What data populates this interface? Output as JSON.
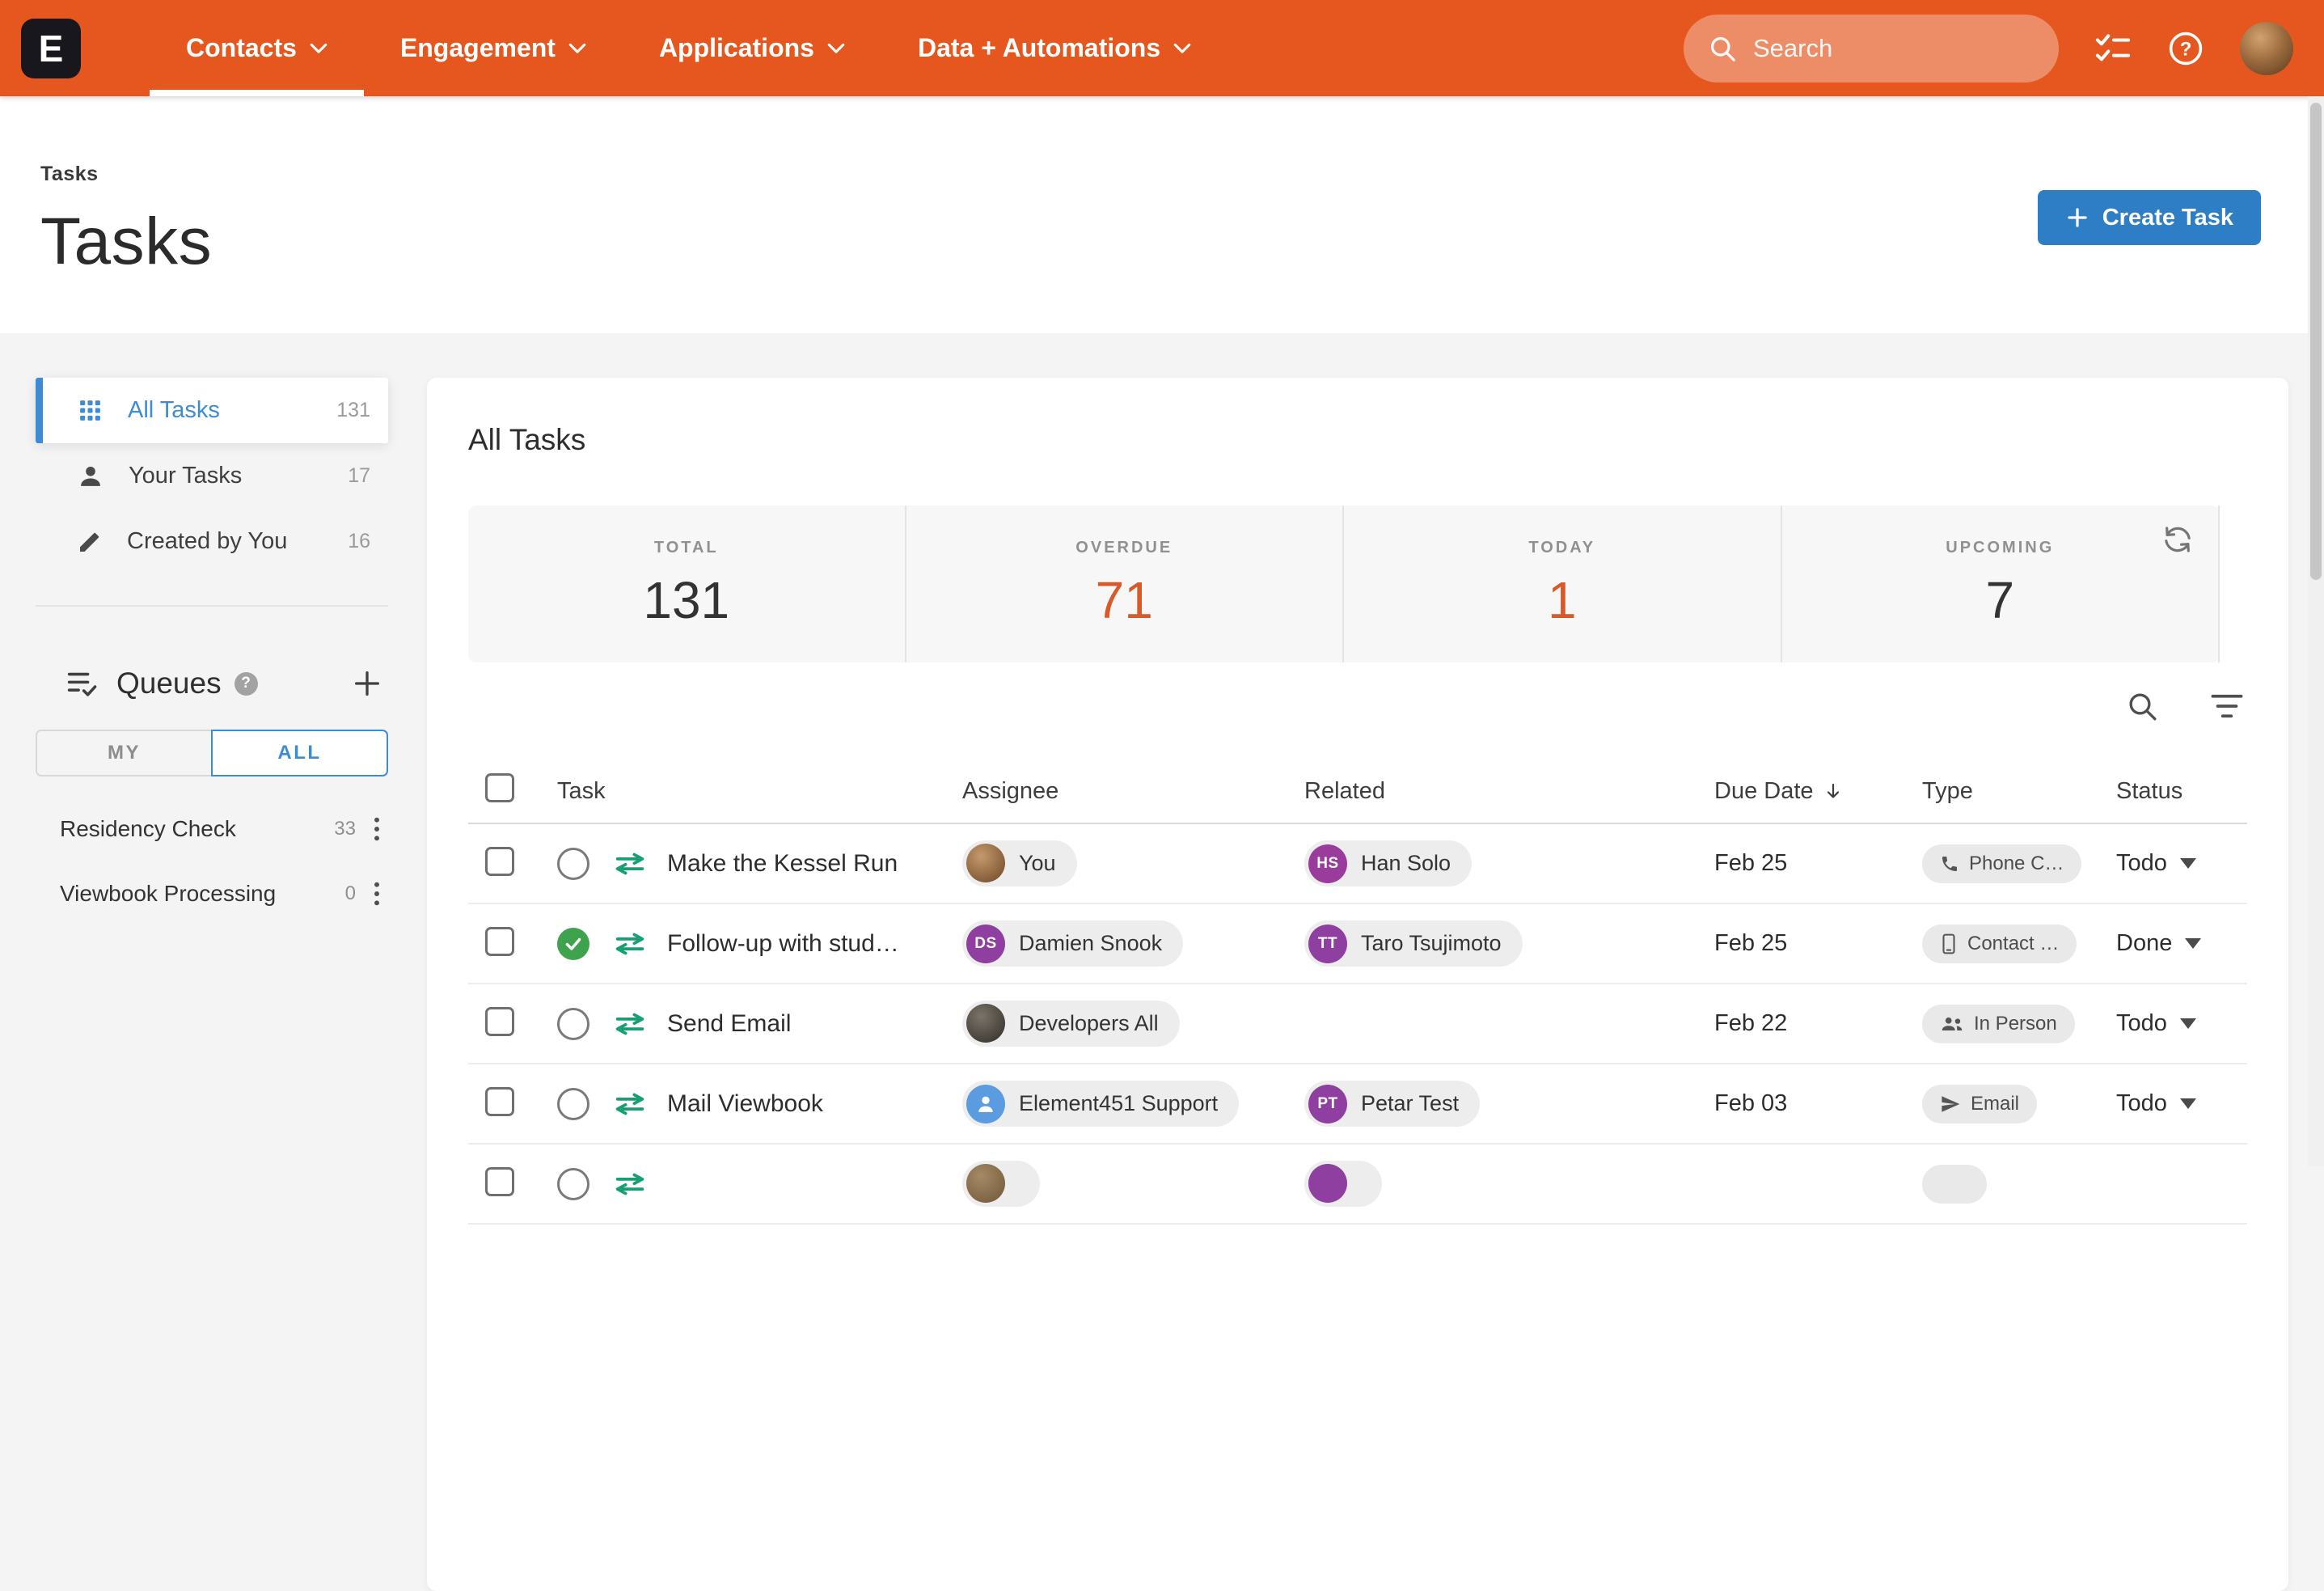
{
  "colors": {
    "header_orange": "#e5571f",
    "button_blue": "#2e7ec6",
    "link_blue": "#3d8bd4",
    "highlight_orange": "#d75a2b",
    "done_green": "#3fa24c",
    "transfer_green": "#16a071"
  },
  "header": {
    "logo": "E",
    "nav": [
      {
        "label": "Contacts",
        "active": true
      },
      {
        "label": "Engagement",
        "active": false
      },
      {
        "label": "Applications",
        "active": false
      },
      {
        "label": "Data + Automations",
        "active": false
      }
    ],
    "search_placeholder": "Search"
  },
  "page": {
    "breadcrumb": "Tasks",
    "title": "Tasks",
    "create_button": "Create Task"
  },
  "sidebar": {
    "items": [
      {
        "label": "All Tasks",
        "count": "131",
        "active": true,
        "icon": "grid"
      },
      {
        "label": "Your Tasks",
        "count": "17",
        "active": false,
        "icon": "person"
      },
      {
        "label": "Created by You",
        "count": "16",
        "active": false,
        "icon": "pencil"
      }
    ],
    "queues": {
      "title": "Queues",
      "help_glyph": "?",
      "tabs": [
        "MY",
        "ALL"
      ],
      "active_tab": "ALL",
      "rows": [
        {
          "label": "Residency Check",
          "count": "33"
        },
        {
          "label": "Viewbook Processing",
          "count": "0"
        }
      ]
    }
  },
  "main": {
    "title": "All Tasks",
    "stats": [
      {
        "label": "TOTAL",
        "value": "131",
        "highlight": false
      },
      {
        "label": "OVERDUE",
        "value": "71",
        "highlight": true
      },
      {
        "label": "TODAY",
        "value": "1",
        "highlight": true
      },
      {
        "label": "UPCOMING",
        "value": "7",
        "highlight": false
      }
    ],
    "table": {
      "columns": [
        {
          "label": "Task"
        },
        {
          "label": "Assignee"
        },
        {
          "label": "Related"
        },
        {
          "label": "Due Date",
          "sorted": "desc"
        },
        {
          "label": "Type"
        },
        {
          "label": "Status"
        }
      ],
      "rows": [
        {
          "task": "Make the Kessel Run",
          "done": false,
          "assignee": {
            "name": "You",
            "avatar": "photo",
            "photo_colors": [
              "#c59a6d",
              "#6e4526"
            ]
          },
          "related": {
            "name": "Han Solo",
            "avatar": "initials",
            "initials": "HS",
            "color": "#993c9c"
          },
          "due": "Feb 25",
          "type": {
            "label": "Phone C…",
            "icon": "phone"
          },
          "status": "Todo"
        },
        {
          "task": "Follow-up with stud…",
          "done": true,
          "assignee": {
            "name": "Damien Snook",
            "avatar": "initials",
            "initials": "DS",
            "color": "#8e3fa0"
          },
          "related": {
            "name": "Taro Tsujimoto",
            "avatar": "initials",
            "initials": "TT",
            "color": "#8e3fa0"
          },
          "due": "Feb 25",
          "type": {
            "label": "Contact …",
            "icon": "contact"
          },
          "status": "Done"
        },
        {
          "task": "Send Email",
          "done": false,
          "assignee": {
            "name": "Developers All",
            "avatar": "photo",
            "photo_colors": [
              "#7b746a",
              "#2f2b26"
            ]
          },
          "related": null,
          "due": "Feb 22",
          "type": {
            "label": "In Person",
            "icon": "people"
          },
          "status": "Todo"
        },
        {
          "task": "Mail Viewbook",
          "done": false,
          "assignee": {
            "name": "Element451 Support",
            "avatar": "person-icon",
            "color": "#5b9ce0"
          },
          "related": {
            "name": "Petar Test",
            "avatar": "initials",
            "initials": "PT",
            "color": "#8e3fa0"
          },
          "due": "Feb 03",
          "type": {
            "label": "Email",
            "icon": "email"
          },
          "status": "Todo"
        },
        {
          "partial": true,
          "task": "",
          "done": false,
          "assignee": {
            "name": "",
            "avatar": "photo",
            "photo_colors": [
              "#a58a66",
              "#6f5638"
            ]
          },
          "related": {
            "name": "",
            "avatar": "initials",
            "initials": "",
            "color": "#8e3fa0"
          },
          "due": "",
          "type": {
            "label": "",
            "icon": null
          },
          "status": ""
        }
      ]
    }
  }
}
